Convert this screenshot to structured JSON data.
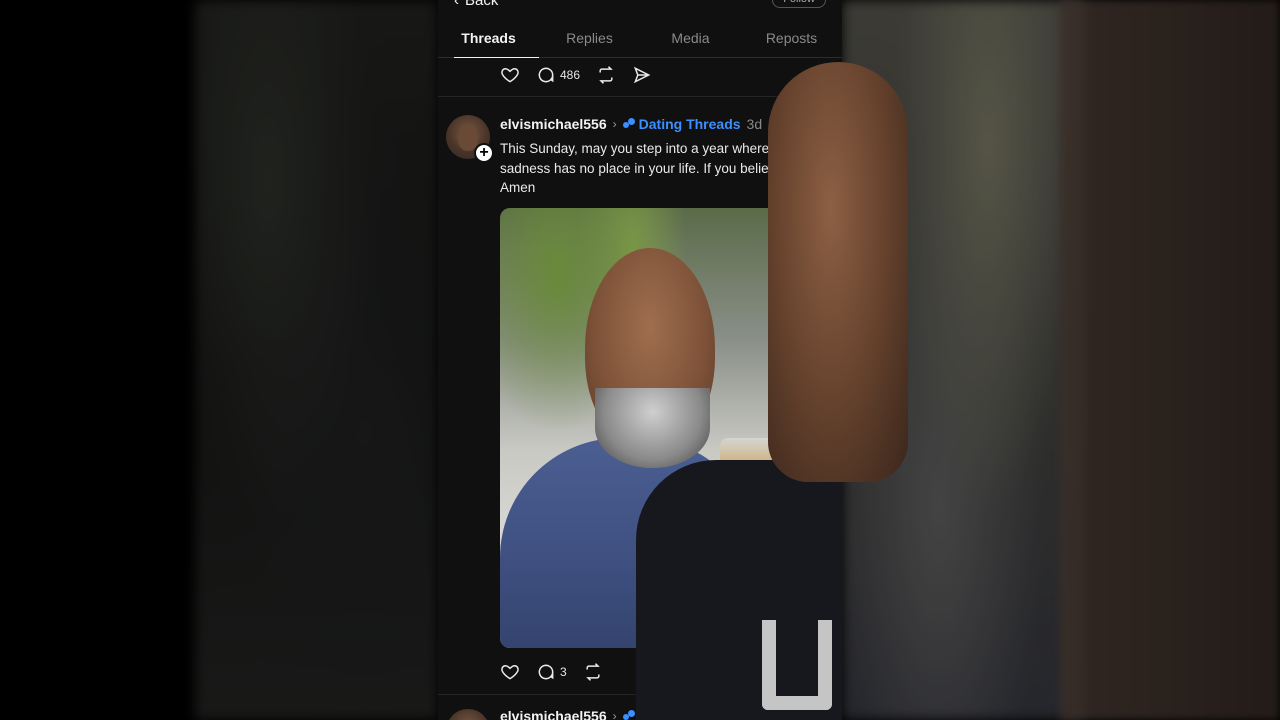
{
  "header": {
    "back_label": "Back",
    "follow_label": "Follow"
  },
  "tabs": [
    {
      "label": "Threads",
      "active": true
    },
    {
      "label": "Replies",
      "active": false
    },
    {
      "label": "Media",
      "active": false
    },
    {
      "label": "Reposts",
      "active": false
    }
  ],
  "prev_post_actions": {
    "comment_count": "486"
  },
  "post": {
    "username": "elvismichael556",
    "community": "Dating Threads",
    "time": "3d",
    "text_lines": [
      "This Sunday, may you step into a year where",
      "sadness has no place in your life. If you belie",
      "Amen"
    ],
    "comment_count": "3"
  },
  "next_post": {
    "username": "elvismichael556"
  },
  "colors": {
    "accent": "#3b8fff",
    "background": "#101010"
  }
}
